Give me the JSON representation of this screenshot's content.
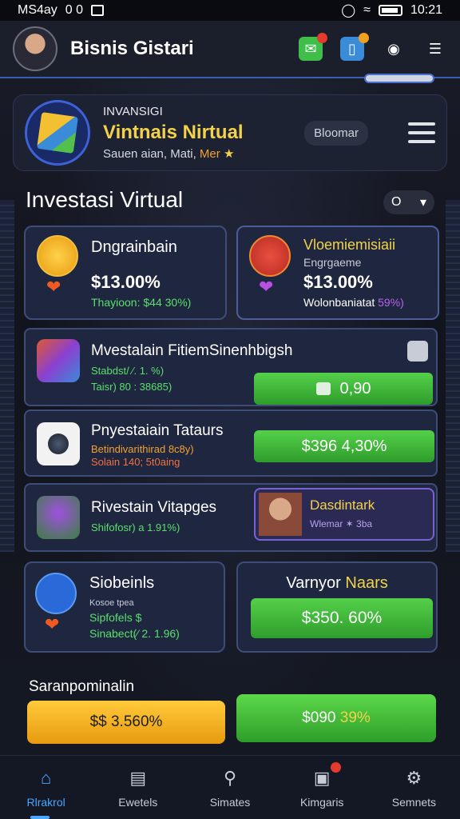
{
  "status_bar": {
    "left": "MS4ay",
    "left2": "0 0",
    "time": "10:21"
  },
  "app": {
    "title": "Bisnis Gistari"
  },
  "hero": {
    "kicker": "INVANSIGI",
    "title": "Vintnais Nirtual",
    "subtitle": "Sauen aian, Mati,",
    "subtitle_accent": "Mer",
    "button": "Bloomar"
  },
  "section": {
    "title": "Investasi Virtual",
    "selector": "O"
  },
  "cards_top": [
    {
      "title": "Dngrainbain",
      "value": "$13.00%",
      "sub": "Thayioon: $44 30%)",
      "sub_color": "#59e06a"
    },
    {
      "title": "Vloemiemisiaii",
      "kicker": "Engrgaeme",
      "value": "$13.00%",
      "sub": "Wolonbaniatat",
      "sub_accent": "59%)",
      "title_color": "#f3d24a"
    }
  ],
  "rows": [
    {
      "title": "Mvestalain FitiemSinenhbigsh",
      "sub1": "Stabdst/ ⁄. 1. %)",
      "sub2": "Taisr) 80 : 38685)",
      "button": "0,90"
    },
    {
      "title": "Pnyestaiain Tataurs",
      "sub1": "Betindivarithirad 8c8y)",
      "sub2": "Solain 140; 5t0aing",
      "button": "$396 4,30%"
    },
    {
      "title": "Rivestain Vitapges",
      "sub1": "Shifofosr) а 1.91%)",
      "badge_title": "Dasdintark",
      "badge_sub": "Wlemar ✶ 3ba"
    }
  ],
  "cards_bottom": [
    {
      "title": "Siobeinls",
      "sub0": "Kosoe tpea",
      "sub1": "Sipfofels $",
      "sub2": "Sinabect(⁄ 2. 1.96)"
    },
    {
      "title": "Varnyor",
      "title_accent": "Naars",
      "button": "$350. 60%"
    }
  ],
  "footer": {
    "label": "Saranpominalin",
    "left_button": "$$ 3.560%",
    "right_button": "$090",
    "right_accent": "39%"
  },
  "nav": [
    {
      "label": "Rlrakrol",
      "active": true
    },
    {
      "label": "Ewetels",
      "active": false
    },
    {
      "label": "Simates",
      "active": false
    },
    {
      "label": "Kimgaris",
      "active": false
    },
    {
      "label": "Semnets",
      "active": false
    }
  ],
  "colors": {
    "accent_blue": "#3a5fb0",
    "gold": "#f3d24a",
    "green": "#54d04a",
    "card_bg": "#1f2740"
  },
  "icons": [
    "message-icon",
    "wallet-icon",
    "location-icon",
    "menu-icon",
    "home-icon",
    "list-icon",
    "search-icon",
    "camera-icon",
    "gear-icon"
  ]
}
